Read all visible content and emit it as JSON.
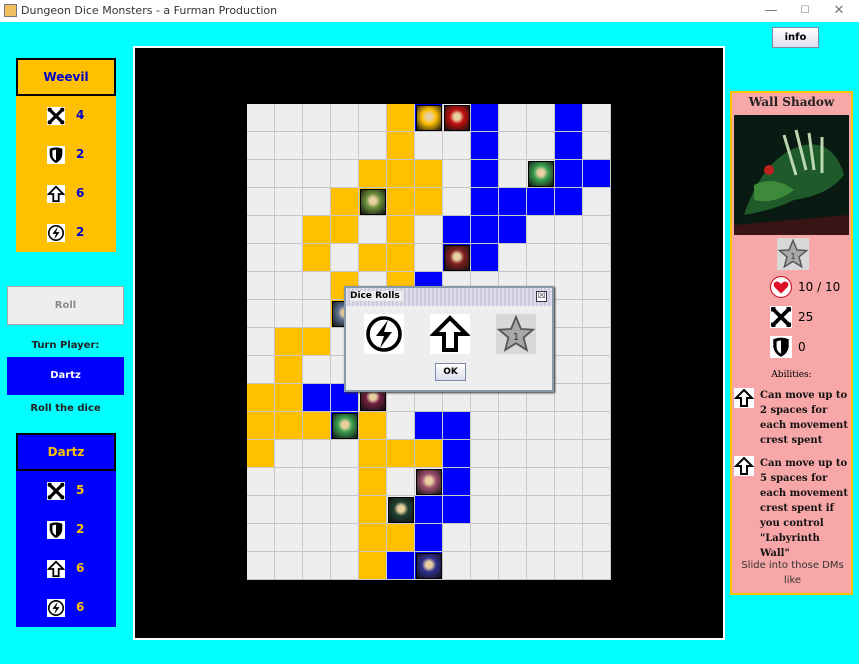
{
  "window": {
    "title": "Dungeon Dice Monsters - a Furman Production",
    "minimize": "—",
    "maximize": "☐",
    "close": "✕"
  },
  "info_button": "info",
  "player_top": {
    "name": "Weevil",
    "attack": "4",
    "defense": "2",
    "movement": "6",
    "magic": "2",
    "color": "#ffc000",
    "name_color": "#0000cc"
  },
  "player_bottom": {
    "name": "Dartz",
    "attack": "5",
    "defense": "2",
    "movement": "6",
    "magic": "6",
    "color": "#0000ff",
    "name_color": "#ffc000"
  },
  "roll_button": "Roll",
  "turn_label": "Turn Player:",
  "turn_player": "Dartz",
  "status": "Roll the dice",
  "dialog": {
    "title": "Dice Rolls",
    "close": "☒",
    "dice": [
      "magic",
      "movement",
      "summon-star"
    ],
    "ok": "OK"
  },
  "card": {
    "name": "Wall Shadow",
    "crest": "summon-star-1",
    "hp": "10 / 10",
    "attack": "25",
    "defense": "0",
    "abilities_label": "Abilities:",
    "abilities": [
      "Can move up to 2 spaces for each movement crest spent",
      "Can move up to 5 spaces for each movement crest spent if you control \"Labyrinth Wall\""
    ],
    "flavor": "Slide into those DMs like"
  },
  "board": {
    "cols": 13,
    "rows": 17,
    "colors": {
      "empty": "#eeeeee",
      "player_top": "#ffc000",
      "player_bottom": "#0000ff"
    },
    "grid": [
      ".....yB.B..B.",
      ".....y..B..B.",
      "....yyy.B..BB",
      "...yyyy.BBBB.",
      "..yy.y.BBB...",
      "..y.yy.BB....",
      "...y.yB......",
      "...y.yBB.....",
      ".yy.y.BB.....",
      ".y..y.BB.....",
      "yyBB.........",
      "yyyBy.BB.....",
      "y...yyyB.....",
      "....y..B.....",
      "....y.BB.....",
      "....yyB......",
      "....yBB......"
    ],
    "monsters": [
      {
        "row": 0,
        "col": 6,
        "color": "#ffc000",
        "name": "ninja-monster"
      },
      {
        "row": 0,
        "col": 7,
        "color": "#c01010",
        "name": "fire-monster"
      },
      {
        "row": 2,
        "col": 10,
        "color": "#3aa050",
        "name": "serpent-monster"
      },
      {
        "row": 3,
        "col": 4,
        "color": "#6b8f3a",
        "name": "insect-monster"
      },
      {
        "row": 5,
        "col": 7,
        "color": "#802020",
        "name": "fiend-monster"
      },
      {
        "row": 7,
        "col": 3,
        "color": "#5a7090",
        "name": "armor-monster"
      },
      {
        "row": 10,
        "col": 4,
        "color": "#702040",
        "name": "dark-monster"
      },
      {
        "row": 11,
        "col": 3,
        "color": "#3aa050",
        "name": "serpent-monster-2"
      },
      {
        "row": 13,
        "col": 6,
        "color": "#a05070",
        "name": "flower-monster"
      },
      {
        "row": 14,
        "col": 5,
        "color": "#204030",
        "name": "wall-shadow-monster"
      },
      {
        "row": 16,
        "col": 6,
        "color": "#303090",
        "name": "warrior-monster"
      }
    ]
  }
}
